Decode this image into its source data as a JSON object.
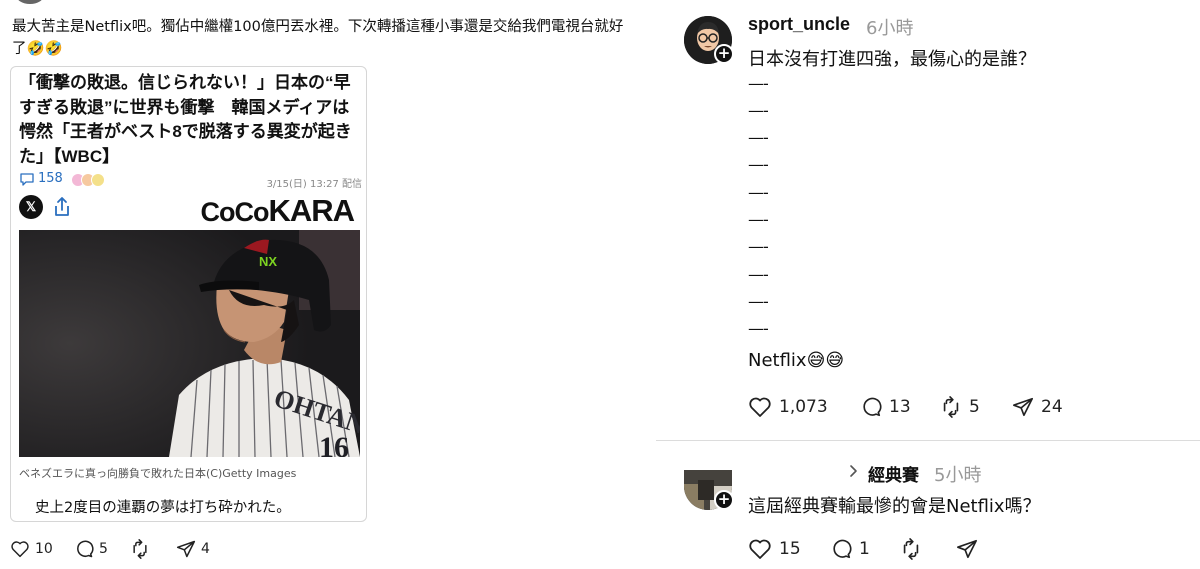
{
  "left_post": {
    "text": "最大苦主是Netflix吧。獨佔中繼權100億円丟水裡。下次轉播這種小事還是交給我們電視台就好了🤣🤣",
    "card": {
      "headline": "「衝撃の敗退。信じられない！」日本の“早すぎる敗退”に世界も衝撃　韓国メディアは愕然「王者がベスト8で脱落する異変が起きた」【WBC】",
      "comment_count": "158",
      "date": "3/15(日) 13:27 配信",
      "x_label": "𝕏",
      "brand_small": "CoCo",
      "brand_big": "KARA",
      "helmet_logo": "NX",
      "jersey_text": "OHTANI",
      "caption": "ベネズエラに真っ向勝負で敗れた日本(C)Getty Images",
      "subtitle": "史上2度目の連覇の夢は打ち砕かれた。"
    },
    "actions": {
      "likes": "10",
      "comments": "5",
      "reposts": "",
      "shares": "4"
    }
  },
  "reply1": {
    "username": "sport_uncle",
    "time": "6小時",
    "line1": "日本沒有打進四強，最傷心的是誰？",
    "dashes": [
      "—-",
      "—-",
      "—-",
      "—-",
      "—-",
      "—-",
      "—-",
      "—-",
      "—-",
      "—-"
    ],
    "answer": "Netflix😅😅",
    "actions": {
      "likes": "1,073",
      "comments": "13",
      "reposts": "5",
      "shares": "24"
    }
  },
  "reply2": {
    "reply_to": "經典賽",
    "time": "5小時",
    "text": "這屆經典賽輸最慘的會是Netflix嗎？",
    "actions": {
      "likes": "15",
      "comments": "1",
      "reposts": "",
      "shares": ""
    }
  },
  "colors": {
    "link_blue": "#2a6fbf",
    "muted": "#999999",
    "text": "#111111",
    "divider": "#dcdcdc"
  },
  "icons": [
    "heart-icon",
    "comment-icon",
    "repost-icon",
    "share-icon",
    "x-logo-icon",
    "share-upload-icon",
    "plus-icon",
    "chevron-right-icon"
  ]
}
